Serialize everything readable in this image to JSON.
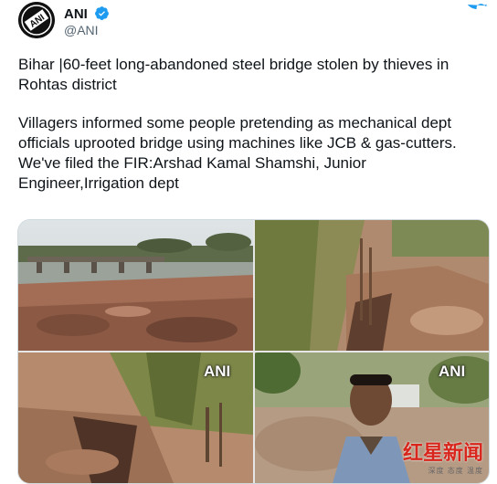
{
  "account": {
    "name": "ANI",
    "handle": "@ANI",
    "avatar_text": "ANI"
  },
  "icons": {
    "verified": "verified-badge-icon",
    "bird": "twitter-bird-icon"
  },
  "colors": {
    "twitter_blue": "#1d9bf0",
    "text": "#0f1419",
    "secondary": "#536471",
    "brand_red": "#d8261d"
  },
  "tweet": {
    "line1": "Bihar |60-feet long-abandoned steel bridge stolen by thieves in Rohtas district",
    "line2": "Villagers informed some people pretending as mechanical dept officials uprooted bridge using machines like JCB & gas-cutters. We've filed the FIR:Arshad Kamal Shamshi, Junior Engineer,Irrigation dept"
  },
  "media": {
    "watermark_3": "ANI",
    "watermark_4": "ANI",
    "brand_main": "红星新闻",
    "brand_sub": "深度 态度 温度"
  }
}
